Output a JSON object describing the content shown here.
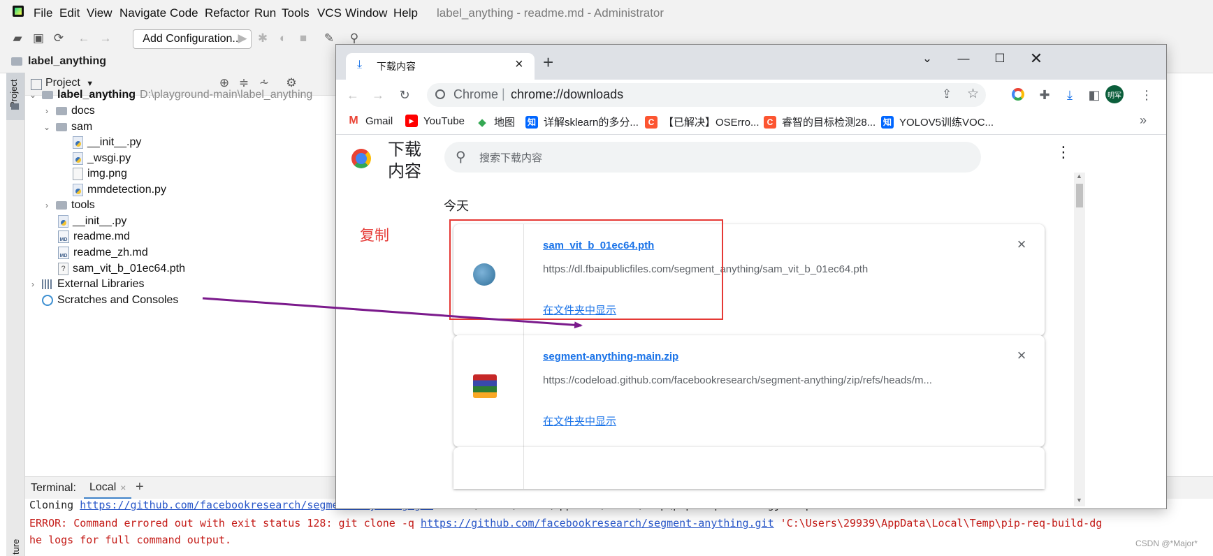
{
  "ide": {
    "menu": [
      "File",
      "Edit",
      "View",
      "Navigate",
      "Code",
      "Refactor",
      "Run",
      "Tools",
      "VCS",
      "Window",
      "Help"
    ],
    "title": "label_anything - readme.md - Administrator",
    "add_config": "Add Configuration...",
    "nav_project": "label_anything",
    "side_tab": "Project",
    "project_header": "Project",
    "tree": {
      "root_name": "label_anything",
      "root_path": "D:\\playground-main\\label_anything",
      "docs": "docs",
      "sam": "sam",
      "sam_init": "__init__.py",
      "sam_wsgi": "_wsgi.py",
      "sam_img": "img.png",
      "sam_mmdet": "mmdetection.py",
      "tools": "tools",
      "init": "__init__.py",
      "readme": "readme.md",
      "readme_zh": "readme_zh.md",
      "pth": "sam_vit_b_01ec64.pth",
      "ext_libs": "External Libraries",
      "scratches": "Scratches and Consoles"
    },
    "md_badge": "MD",
    "terminal": {
      "label": "Terminal:",
      "tab": "Local",
      "line1_prefix": "Cloning ",
      "line1_link": "https://github.com/facebookresearch/segment-anything.git",
      "line1_suffix": " to c:\\users\\29939\\appdata\\local\\temp\\pip-req-build-dgja7klp",
      "line2_prefix": "ERROR: Command errored out with exit status 128: git clone -q ",
      "line2_link": "https://github.com/facebookresearch/segment-anything.git",
      "line2_suffix": " 'C:\\Users\\29939\\AppData\\Local\\Temp\\pip-req-build-dg",
      "line3": "he logs for full command output."
    },
    "bottom_stripe": "ture"
  },
  "chrome": {
    "tab_title": "下载内容",
    "new_tab": "+",
    "omnibox_site": "Chrome",
    "omnibox_url": "chrome://downloads",
    "avatar": "明军",
    "bookmarks": [
      {
        "label": "Gmail",
        "icon": "gmail-icon",
        "color": "#ea4335"
      },
      {
        "label": "YouTube",
        "icon": "youtube-icon",
        "color": "#ff0000"
      },
      {
        "label": "地图",
        "icon": "maps-icon",
        "color": "#34a853"
      },
      {
        "label": "详解sklearn的多分...",
        "icon": "zhihu-icon",
        "color": "#0066ff"
      },
      {
        "label": "【已解决】OSErro...",
        "icon": "csdn-icon",
        "color": "#fc5531"
      },
      {
        "label": "睿智的目标检测28...",
        "icon": "csdn-icon",
        "color": "#fc5531"
      },
      {
        "label": "YOLOV5训练VOC...",
        "icon": "zhihu-icon",
        "color": "#0066ff"
      }
    ],
    "bookmark_glyphs": {
      "zhihu": "知",
      "csdn": "C",
      "gmail": "M",
      "youtube": "▶",
      "maps": "◆"
    },
    "more_bookmarks": "»",
    "page_title": "下载\n内容",
    "search_placeholder": "搜索下载内容",
    "section_today": "今天",
    "downloads": [
      {
        "name": "sam_vit_b_01ec64.pth",
        "url": "https://dl.fbaipublicfiles.com/segment_anything/sam_vit_b_01ec64.pth",
        "action": "在文件夹中显示"
      },
      {
        "name": "segment-anything-main.zip",
        "url": "https://codeload.github.com/facebookresearch/segment-anything/zip/refs/heads/m...",
        "action": "在文件夹中显示"
      }
    ]
  },
  "annotation": {
    "text": "复制",
    "color": "#e53935",
    "arrow_color": "#7b1a8c"
  },
  "watermark": "CSDN @*Major*"
}
